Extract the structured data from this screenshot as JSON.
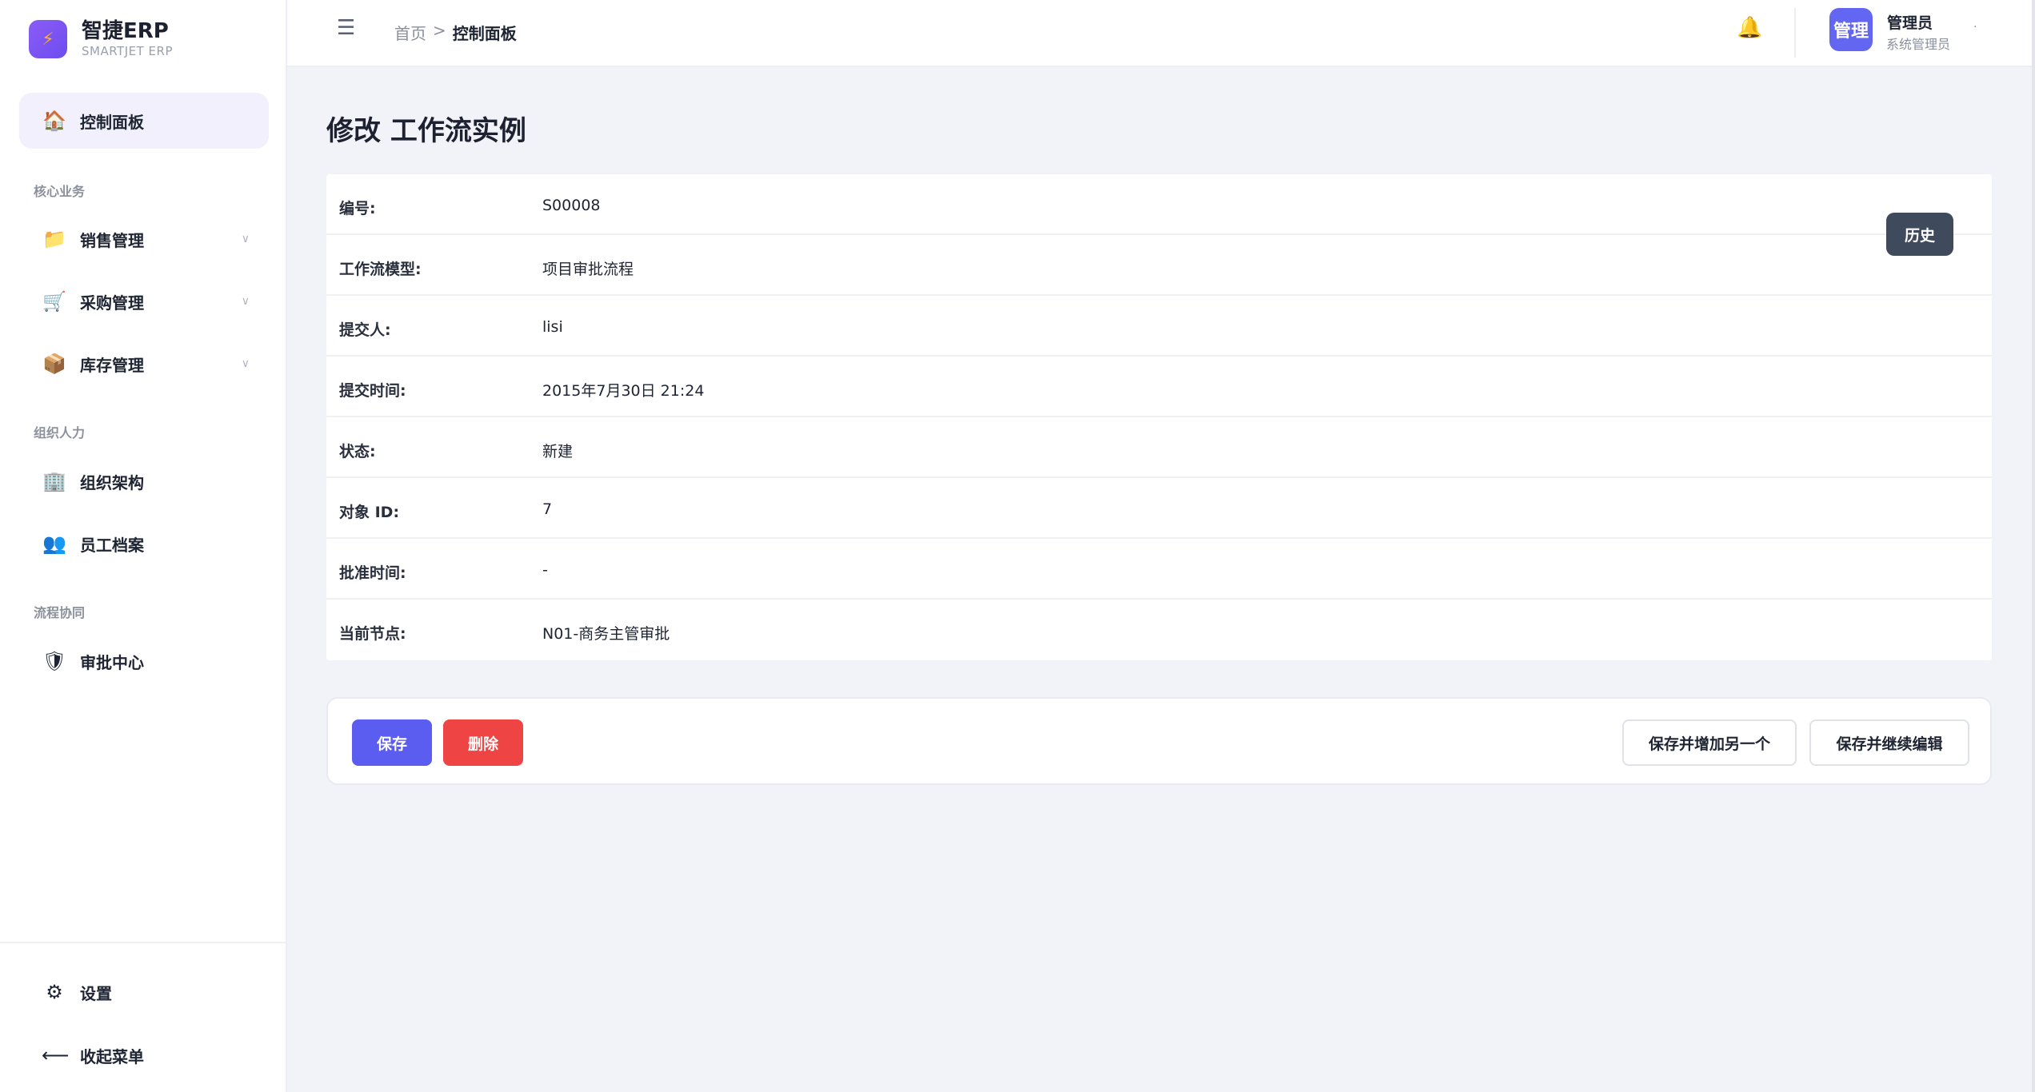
{
  "brand": {
    "logo_icon": "bolt-icon",
    "name": "智捷ERP",
    "subtitle": "SMARTJET ERP"
  },
  "sidebar": {
    "dashboard": {
      "label": "控制面板",
      "icon": "house-icon"
    },
    "sections": [
      {
        "label": "核心业务"
      },
      {
        "label": "组织人力"
      },
      {
        "label": "流程协同"
      }
    ],
    "items": [
      {
        "label": "销售管理",
        "icon": "folder-icon",
        "caret": "∨"
      },
      {
        "label": "采购管理",
        "icon": "cart-icon",
        "caret": "∨"
      },
      {
        "label": "库存管理",
        "icon": "box-icon",
        "caret": "∨"
      },
      {
        "label": "组织架构",
        "icon": "org-icon"
      },
      {
        "label": "员工档案",
        "icon": "people-icon"
      },
      {
        "label": "审批中心",
        "icon": "shield-icon"
      }
    ],
    "settings": {
      "label": "设置",
      "icon": "gear-icon"
    },
    "collapse": {
      "label": "收起菜单",
      "icon": "arrow-left-icon"
    }
  },
  "topbar": {
    "breadcrumb_home": "首页",
    "breadcrumb_sep": ">",
    "breadcrumb_current": "控制面板",
    "avatar_text": "管理",
    "user_name": "管理员",
    "user_role": "系统管理员"
  },
  "page": {
    "title": "修改 工作流实例",
    "history_button": "历史"
  },
  "form": {
    "rows": [
      {
        "label": "编号:",
        "value": "S00008"
      },
      {
        "label": "工作流模型:",
        "value": "项目审批流程"
      },
      {
        "label": "提交人:",
        "value": "lisi"
      },
      {
        "label": "提交时间:",
        "value": "2015年7月30日 21:24"
      },
      {
        "label": "状态:",
        "value": "新建"
      },
      {
        "label": "对象 ID:",
        "value": "7"
      },
      {
        "label": "批准时间:",
        "value": "-"
      },
      {
        "label": "当前节点:",
        "value": "N01-商务主管审批"
      }
    ]
  },
  "actions": {
    "save": "保存",
    "delete": "删除",
    "save_add": "保存并增加另一个",
    "save_continue": "保存并继续编辑"
  },
  "colors": {
    "accent": "#5b5cf0",
    "danger": "#ef4444",
    "history_button": "#3f4a5c",
    "active_nav_bg": "#f1f0fc"
  }
}
